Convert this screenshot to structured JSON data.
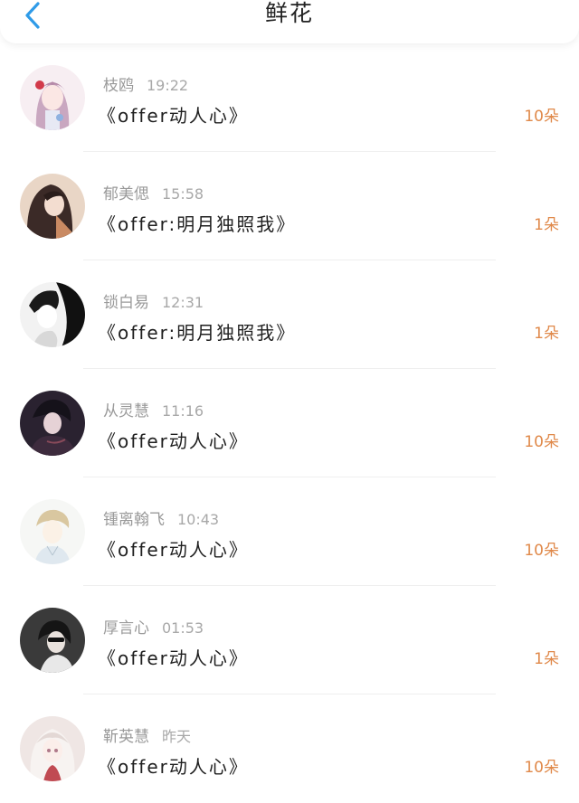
{
  "header": {
    "title": "鲜花",
    "back_icon": "chevron-left-icon"
  },
  "colors": {
    "accent_blue": "#2f9be8",
    "count_orange": "#e0894a"
  },
  "rows": [
    {
      "name": "枝鸥",
      "time": "19:22",
      "gift": "《offer动人心》",
      "count": "10朵",
      "avatar": "anime-girl-avatar"
    },
    {
      "name": "郁美偲",
      "time": "15:58",
      "gift": "《offer:明月独照我》",
      "count": "1朵",
      "avatar": "anime-girl-avatar"
    },
    {
      "name": "锁白易",
      "time": "12:31",
      "gift": "《offer:明月独照我》",
      "count": "1朵",
      "avatar": "monochrome-boy-avatar"
    },
    {
      "name": "从灵慧",
      "time": "11:16",
      "gift": "《offer动人心》",
      "count": "10朵",
      "avatar": "dark-anime-boy-avatar"
    },
    {
      "name": "锺离翰飞",
      "time": "10:43",
      "gift": "《offer动人心》",
      "count": "10朵",
      "avatar": "sketch-boy-avatar"
    },
    {
      "name": "厚言心",
      "time": "01:53",
      "gift": "《offer动人心》",
      "count": "1朵",
      "avatar": "sunglasses-girl-avatar"
    },
    {
      "name": "靳英慧",
      "time": "昨天",
      "gift": "《offer动人心》",
      "count": "10朵",
      "avatar": "white-hair-girl-avatar"
    }
  ]
}
